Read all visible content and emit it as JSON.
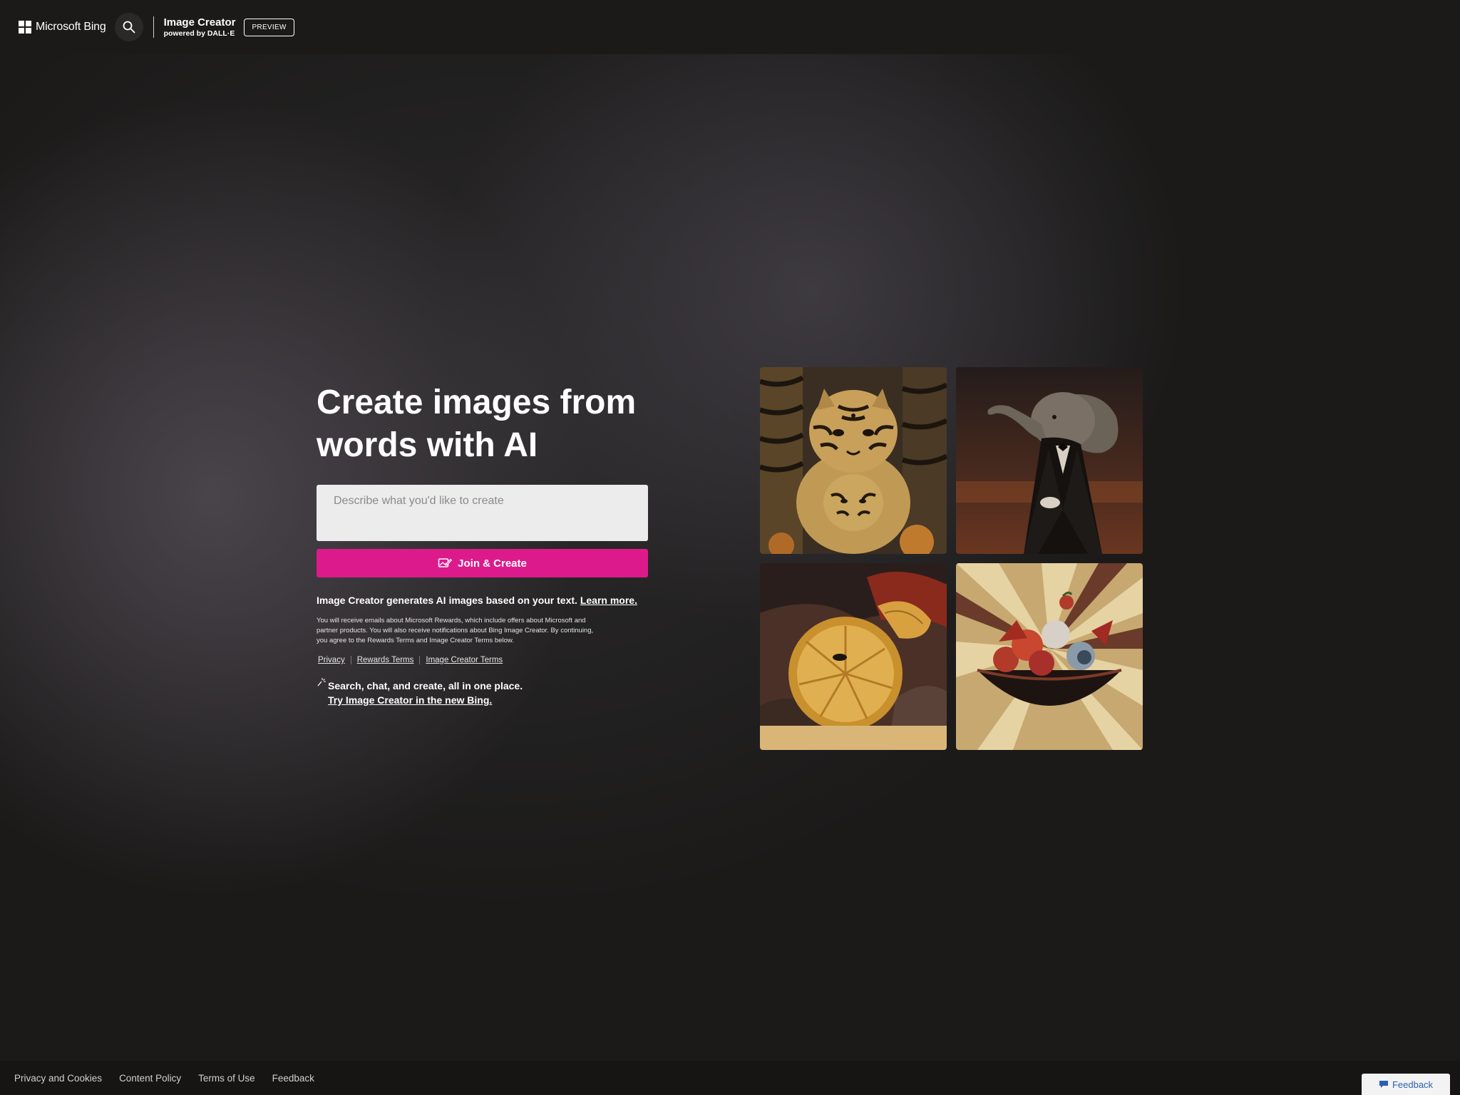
{
  "header": {
    "brand_text": "Microsoft Bing",
    "app_title": "Image Creator",
    "app_sub": "powered by DALL·E",
    "preview_label": "PREVIEW"
  },
  "hero": {
    "title": "Create images from words with AI",
    "prompt_placeholder": "Describe what you'd like to create",
    "join_button": "Join & Create",
    "info_text": "Image Creator generates AI images based on your text.",
    "learn_more": "Learn more.",
    "fineprint": "You will receive emails about Microsoft Rewards, which include offers about Microsoft and partner products. You will also receive notifications about Bing Image Creator. By continuing, you agree to the Rewards Terms and Image Creator Terms below.",
    "legal_links": [
      "Privacy",
      "Rewards Terms",
      "Image Creator Terms"
    ],
    "newbing_line1": "Search, chat, and create, all in one place.",
    "newbing_link": "Try Image Creator in the new Bing."
  },
  "gallery": {
    "images": [
      "tiger-nesting-dolls",
      "elephant-in-tuxedo",
      "orange-slice-still-life",
      "fruit-bowl-geometric"
    ]
  },
  "footer": {
    "links": [
      "Privacy and Cookies",
      "Content Policy",
      "Terms of Use",
      "Feedback"
    ],
    "feedback_button": "Feedback"
  },
  "colors": {
    "background": "#1b1a19",
    "accent": "#dd1a8c",
    "input_bg": "#ececec"
  }
}
